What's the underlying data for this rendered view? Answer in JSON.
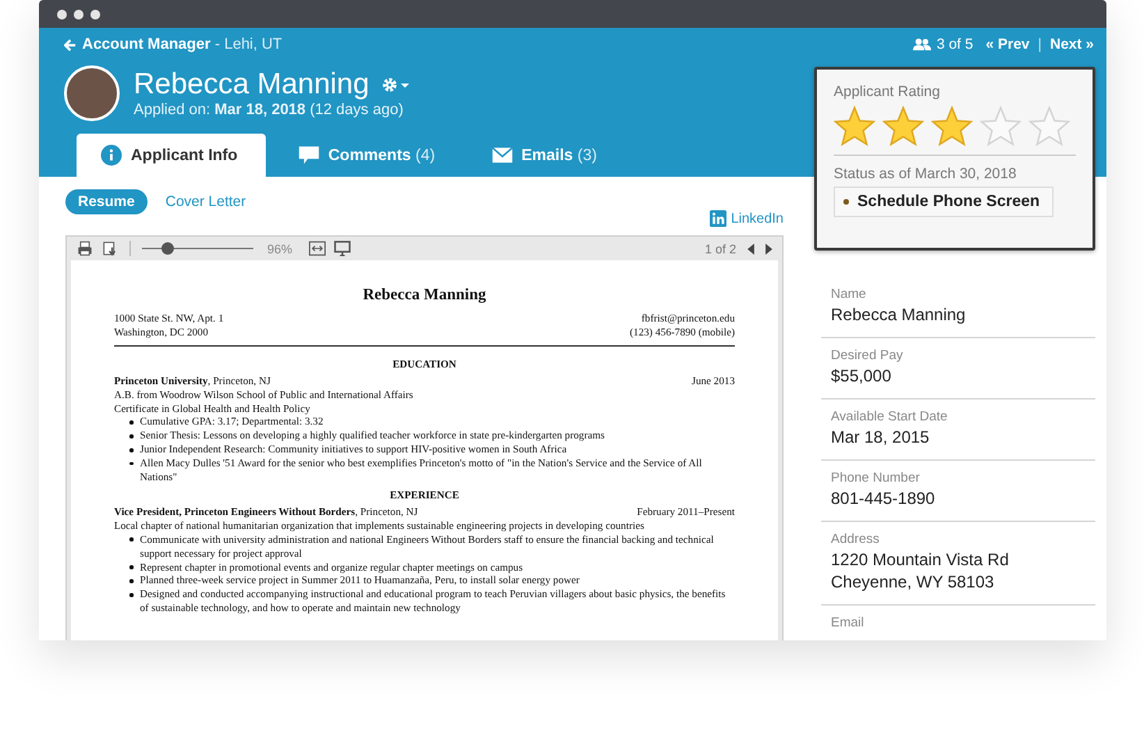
{
  "breadcrumb": {
    "label": "Account Manager",
    "location": "- Lehi, UT"
  },
  "navigation": {
    "position": "3 of 5",
    "prev": "« Prev",
    "separator": "|",
    "next": "Next »"
  },
  "applicant": {
    "name": "Rebecca Manning",
    "applied": "Applied on: **Mar 18, 2018** (12 days ago)"
  },
  "tabs": [
    {
      "kind": "info",
      "label": "Applicant Info",
      "selected": true
    },
    {
      "kind": "comments",
      "label": "Comments",
      "count": "(4)",
      "selected": false
    },
    {
      "kind": "emails",
      "label": "Emails",
      "count": "(3)",
      "selected": false
    }
  ],
  "document_tabs": [
    {
      "label": "Resume",
      "selected": true
    },
    {
      "label": "Cover Letter",
      "selected": false
    }
  ],
  "linkedin": "LinkedIn",
  "viewer": {
    "zoom": {
      "level": 0.23,
      "reading": "96%"
    },
    "page": "1 of 2"
  },
  "resume": {
    "name": "Rebecca Manning",
    "address": [
      "1000 State St. NW, Apt. 1",
      "Washington, DC 2000"
    ],
    "contact": [
      "fbfrist@princeton.edu",
      "(123) 456-7890 (mobile)"
    ],
    "sections": [
      {
        "heading": "EDUCATION",
        "entries": [
          {
            "title": "**Princeton University**, Princeton, NJ",
            "date": "June 2013",
            "lines": [
              "A.B. from Woodrow Wilson School of Public and International Affairs",
              "Certificate in Global Health and Health Policy"
            ],
            "bullets": [
              "Cumulative GPA:  3.17; Departmental: 3.32",
              "Senior Thesis: Lessons on developing a highly qualified teacher workforce in state pre-kindergarten programs",
              "Junior Independent Research:  Community initiatives to support HIV-positive women in South Africa",
              "Allen Macy Dulles '51 Award for the senior who best exemplifies Princeton's motto of  \"in the Nation's Service and the Service of All Nations\""
            ]
          }
        ]
      },
      {
        "heading": "EXPERIENCE",
        "entries": [
          {
            "title": "**Vice President, Princeton Engineers Without Borders**, Princeton, NJ",
            "date": "February 2011–Present",
            "lines": [
              "Local chapter of national humanitarian organization that implements sustainable engineering projects in developing countries"
            ],
            "bullets": [
              "Communicate with university administration and national Engineers Without Borders staff to ensure the financial backing and technical support necessary for project approval",
              "Represent chapter in promotional events and organize regular chapter meetings on campus",
              "Planned three-week service project in Summer 2011 to Huamanzaña, Peru, to install solar energy power",
              "Designed and conducted accompanying instructional and educational program to teach Peruvian villagers about basic physics, the benefits of sustainable technology, and how to operate and maintain new technology"
            ]
          }
        ]
      }
    ]
  },
  "rating": {
    "title": "Applicant Rating",
    "stars": 3,
    "status_label": "Status as of March 30, 2018",
    "status": "Schedule Phone Screen"
  },
  "details": [
    {
      "label": "Name",
      "lines": [
        "Rebecca Manning"
      ]
    },
    {
      "label": "Desired Pay",
      "lines": [
        "$55,000"
      ]
    },
    {
      "label": "Available Start Date",
      "lines": [
        "Mar 18, 2015"
      ]
    },
    {
      "label": "Phone Number",
      "lines": [
        "801-445-1890"
      ]
    },
    {
      "label": "Address",
      "lines": [
        "1220 Mountain Vista Rd",
        "Cheyenne, WY 58103"
      ]
    },
    {
      "label": "Email"
    }
  ]
}
